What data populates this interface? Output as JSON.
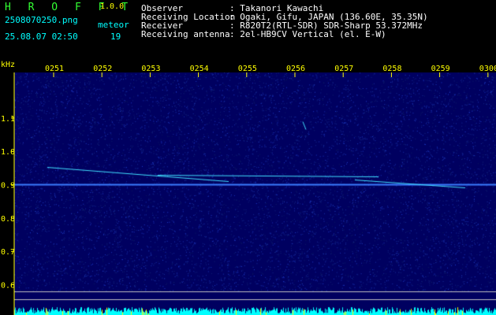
{
  "app": {
    "brand": "H R O F F T",
    "version": "1.0.0",
    "filename": "2508070250.png",
    "meteor_label": "meteor",
    "datetime": "25.08.07 02:50",
    "meteor_count": "19"
  },
  "info": [
    {
      "key": "Observer",
      "value": ": Takanori Kawachi"
    },
    {
      "key": "Receiving Location",
      "value": ": Ogaki, Gifu, JAPAN (136.60E, 35.35N)"
    },
    {
      "key": "Receiver",
      "value": ": R820T2(RTL-SDR) SDR-Sharp 53.372MHz"
    },
    {
      "key": "Receiving antenna",
      "value": ": 2el-HB9CV Vertical (el. E-W)"
    }
  ],
  "chart_data": {
    "type": "heatmap",
    "ylabel": "kHz",
    "x_ticks": [
      "0251",
      "0252",
      "0253",
      "0254",
      "0255",
      "0256",
      "0257",
      "0258",
      "0259",
      "0300"
    ],
    "y_ticks": [
      "1.1",
      "1.0",
      "0.9",
      "0.8",
      "0.7",
      "0.6"
    ],
    "ylim": [
      0.58,
      1.18
    ],
    "carrier_khz": 0.9,
    "colors": {
      "background": "#000060",
      "noise": "#2030c0",
      "signal": "#40e0ff",
      "axis": "#ffff00",
      "activity": "#00ffff"
    }
  }
}
